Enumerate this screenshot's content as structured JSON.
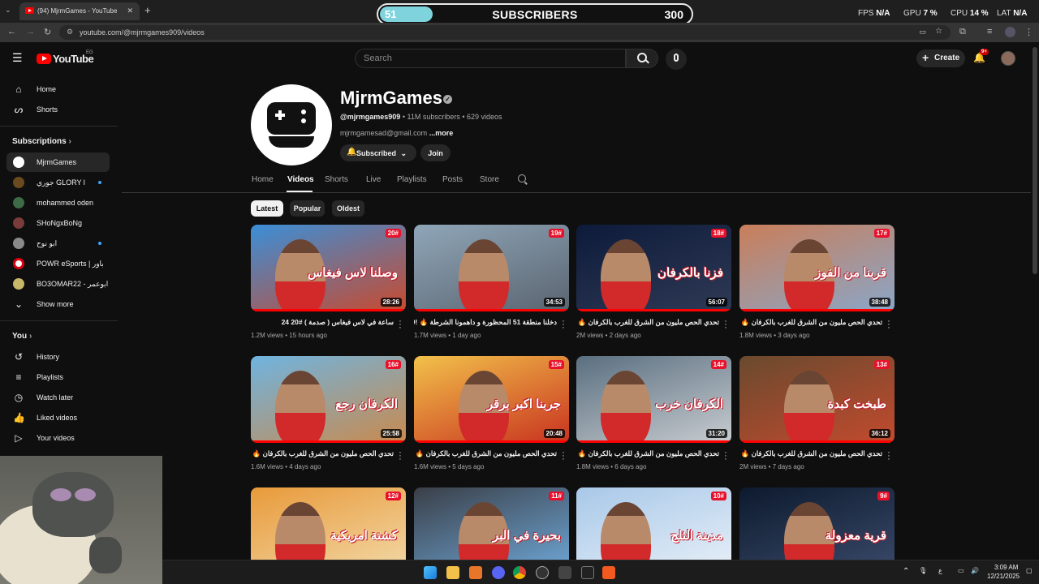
{
  "browser": {
    "tab_title": "(94) MjrmGames - YouTube",
    "url": "youtube.com/@mjrmgames909/videos"
  },
  "overlay": {
    "left_count": "51",
    "label": "SUBSCRIBERS",
    "goal": "300",
    "progress": 0.17,
    "fps_label": "FPS",
    "fps_value": "N/A",
    "gpu_label": "GPU",
    "gpu_value": "7 %",
    "cpu_label": "CPU",
    "cpu_value": "14 %",
    "lat_label": "LAT",
    "lat_value": "N/A"
  },
  "header": {
    "logo_text": "YouTube",
    "region": "EG",
    "search_placeholder": "Search",
    "create_label": "Create",
    "notification_badge": "9+"
  },
  "sidebar": {
    "main": [
      {
        "label": "Home",
        "icon": "home-icon"
      },
      {
        "label": "Shorts",
        "icon": "shorts-icon"
      }
    ],
    "subscriptions_title": "Subscriptions",
    "subscriptions": [
      {
        "label": "MjrmGames",
        "color": "#ffffff",
        "active": true,
        "dot": false
      },
      {
        "label": "جوري GLORY l",
        "color": "#6b4a1f",
        "active": false,
        "dot": true
      },
      {
        "label": "mohammed oden",
        "color": "#3d6b45",
        "active": false,
        "dot": false
      },
      {
        "label": "SHoNgxBoNg",
        "color": "#7a3b3b",
        "active": false,
        "dot": false
      },
      {
        "label": "ابو نوح",
        "color": "#8a8a8a",
        "active": false,
        "dot": true
      },
      {
        "label": "POWR eSports | باور",
        "color": "#ffffff",
        "active": false,
        "dot": false
      },
      {
        "label": "BO3OMAR22 - ابوعمر",
        "color": "#c8b86a",
        "active": false,
        "dot": false
      }
    ],
    "show_more": "Show more",
    "you_title": "You",
    "you": [
      {
        "label": "History",
        "icon": "history-icon"
      },
      {
        "label": "Playlists",
        "icon": "playlists-icon"
      },
      {
        "label": "Watch later",
        "icon": "watch-later-icon"
      },
      {
        "label": "Liked videos",
        "icon": "thumbs-up-icon"
      },
      {
        "label": "Your videos",
        "icon": "your-videos-icon"
      }
    ]
  },
  "channel": {
    "name": "MjrmGames",
    "handle": "@mjrmgames909",
    "stats": " • 11M subscribers • 629 videos",
    "email": "mjrmgamesad@gmail.com",
    "more": "...more",
    "subscribed_label": "Subscribed",
    "join_label": "Join",
    "tabs": [
      "Home",
      "Videos",
      "Shorts",
      "Live",
      "Playlists",
      "Posts",
      "Store"
    ],
    "active_tab": "Videos",
    "filters": [
      "Latest",
      "Popular",
      "Oldest"
    ],
    "active_filter": "Latest"
  },
  "videos": [
    {
      "title": "ساعة في لاس فيغاس ( صدمة ) #20 24",
      "views": "1.2M views",
      "age": "15 hours ago",
      "duration": "28:26",
      "badge": "20#",
      "overlay_text": "وصلنا لاس فيغاس",
      "bg1": "#3a8fd8",
      "bg2": "#c94a2e"
    },
    {
      "title": "دخلنا منطقة 51 المحظورة و داهمونا الشرطة 🔥 !19#",
      "views": "1.7M views",
      "age": "1 day ago",
      "duration": "34:53",
      "badge": "19#",
      "overlay_text": "",
      "bg1": "#8fa6b8",
      "bg2": "#5a6470"
    },
    {
      "title": "تحدي الحص مليون من الشرق للغرب بالكرفان 🔥 !18#",
      "views": "2M views",
      "age": "2 days ago",
      "duration": "56:07",
      "badge": "18#",
      "overlay_text": "فزنا بالكرفان",
      "bg1": "#0d1a3a",
      "bg2": "#2e3a55"
    },
    {
      "title": "تحدي الحص مليون من الشرق للغرب بالكرفان 🔥 !17#",
      "views": "1.8M views",
      "age": "3 days ago",
      "duration": "38:48",
      "badge": "17#",
      "overlay_text": "قربنا من الفوز",
      "bg1": "#c97e5a",
      "bg2": "#8aa6c8"
    },
    {
      "title": "تحدي الحص مليون من الشرق للغرب بالكرفان 🔥 !16#",
      "views": "1.6M views",
      "age": "4 days ago",
      "duration": "25:58",
      "badge": "16#",
      "overlay_text": "الكرفان رجع",
      "bg1": "#6fb4e0",
      "bg2": "#c98a4e"
    },
    {
      "title": "تحدي الحص مليون من الشرق للغرب بالكرفان 🔥 !15#",
      "views": "1.6M views",
      "age": "5 days ago",
      "duration": "20:48",
      "badge": "15#",
      "overlay_text": "جربنا اكبر برقر",
      "bg1": "#f2c14a",
      "bg2": "#c8321f"
    },
    {
      "title": "تحدي الحص مليون من الشرق للغرب بالكرفان 🔥 !14#",
      "views": "1.8M views",
      "age": "6 days ago",
      "duration": "31:20",
      "badge": "14#",
      "overlay_text": "الكرفان خرب",
      "bg1": "#5a6f80",
      "bg2": "#c8ccd0"
    },
    {
      "title": "تحدي الحص مليون من الشرق للغرب بالكرفان 🔥 !13#",
      "views": "2M views",
      "age": "7 days ago",
      "duration": "36:12",
      "badge": "13#",
      "overlay_text": "طبخت كبدة",
      "bg1": "#6a4a2e",
      "bg2": "#c24a2e"
    },
    {
      "title": "",
      "views": "",
      "age": "",
      "duration": "",
      "badge": "12#",
      "overlay_text": "كشتة امريكية",
      "bg1": "#e89a3a",
      "bg2": "#f2d9a8"
    },
    {
      "title": "",
      "views": "",
      "age": "",
      "duration": "",
      "badge": "11#",
      "overlay_text": "بحيرة في البر",
      "bg1": "#3a3f48",
      "bg2": "#6fa8d8"
    },
    {
      "title": "",
      "views": "",
      "age": "",
      "duration": "",
      "badge": "10#",
      "overlay_text": "مدينة الثلج",
      "bg1": "#a8c8e8",
      "bg2": "#e8f0f8"
    },
    {
      "title": "",
      "views": "",
      "age": "",
      "duration": "",
      "badge": "9#",
      "overlay_text": "قرية معزولة",
      "bg1": "#0d1a2e",
      "bg2": "#3a4a6a"
    }
  ],
  "taskbar": {
    "time": "3:09 AM",
    "date": "12/21/2025",
    "lang": "ع"
  },
  "colors": {
    "accent": "#ff0000",
    "link": "#3ea6ff",
    "background": "#0f0f0f"
  }
}
